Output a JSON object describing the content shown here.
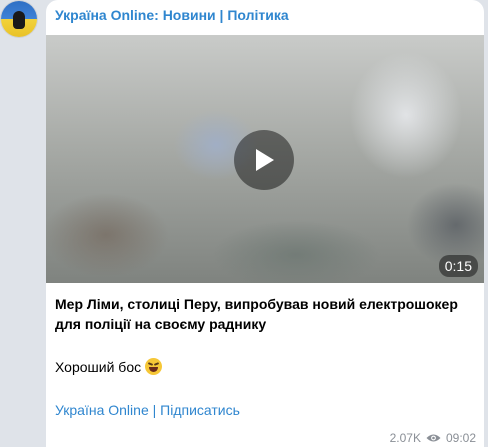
{
  "post": {
    "channel_title": "Україна Online: Новини | Політика",
    "video": {
      "duration": "0:15"
    },
    "headline": "Мер Ліми, столиці Перу, випробував новий електрошокер для поліції на своєму раднику",
    "comment": "Хороший бос",
    "comment_emoji": "laughing-with-tears-emoji",
    "subscribe_link": "Україна Online | Підписатись",
    "views": "2.07K",
    "time": "09:02"
  },
  "colors": {
    "accent": "#2f86cf",
    "background": "#dfe3e9",
    "meta_text": "#8a8f96"
  }
}
